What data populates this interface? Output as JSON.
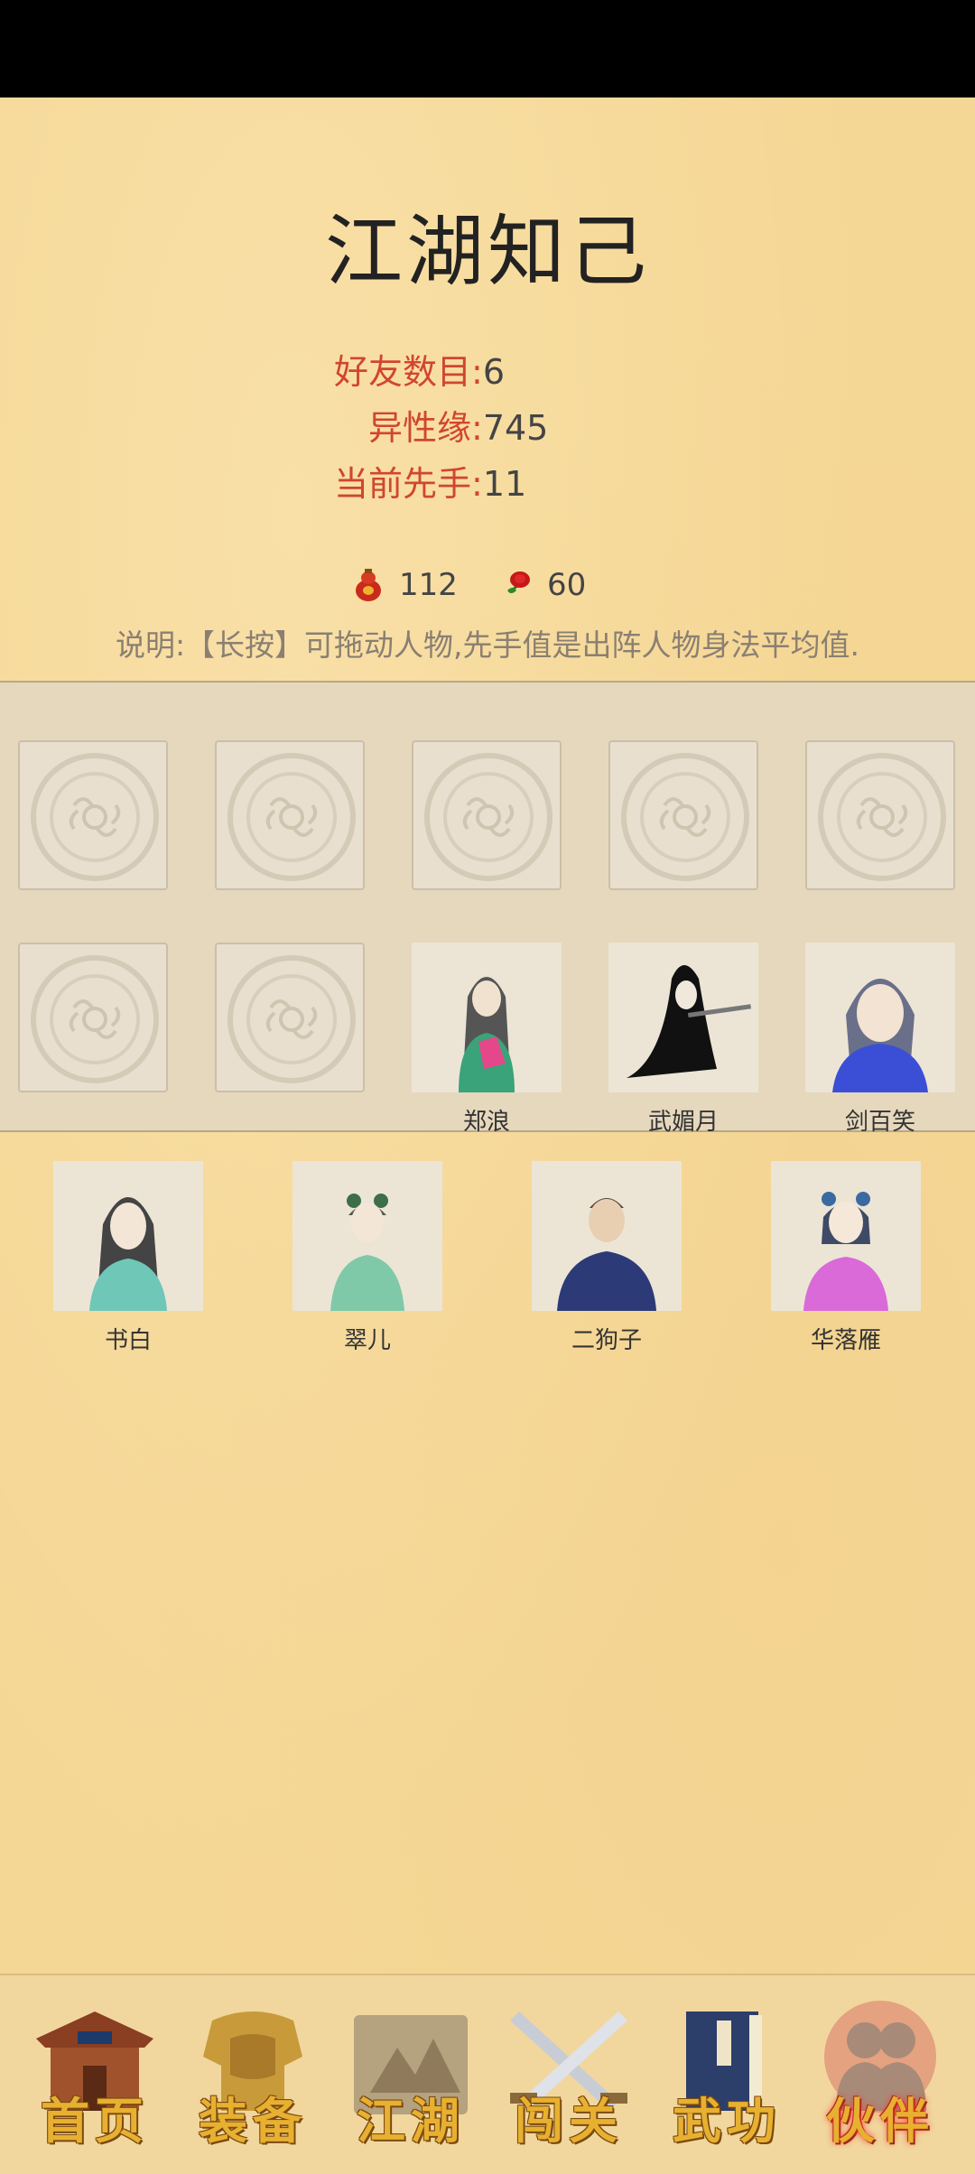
{
  "page": {
    "title": "江湖知己",
    "stats": [
      {
        "label": "好友数目:",
        "value": "6"
      },
      {
        "label": "异性缘:",
        "value": "745"
      },
      {
        "label": "当前先手:",
        "value": "11"
      }
    ],
    "currency": [
      {
        "icon": "red-gourd-icon",
        "value": "112"
      },
      {
        "icon": "rose-icon",
        "value": "60"
      }
    ],
    "note": "说明:【长按】可拖动人物,先手值是出阵人物身法平均值."
  },
  "lineup": {
    "empty_slots": 7,
    "characters": [
      {
        "name": "郑浪",
        "color": "#3aa37a"
      },
      {
        "name": "武媚月",
        "color": "#111111"
      },
      {
        "name": "剑百笑",
        "color": "#3a4fd6"
      }
    ]
  },
  "reserve": {
    "characters": [
      {
        "name": "书白",
        "color": "#6fc7b8"
      },
      {
        "name": "翠儿",
        "color": "#7fc9a8"
      },
      {
        "name": "二狗子",
        "color": "#2c3a78"
      },
      {
        "name": "华落雁",
        "color": "#d96ad8"
      }
    ]
  },
  "nav": {
    "items": [
      {
        "label": "首页",
        "icon": "house-icon"
      },
      {
        "label": "装备",
        "icon": "armor-icon"
      },
      {
        "label": "江湖",
        "icon": "scroll-map-icon"
      },
      {
        "label": "闯关",
        "icon": "crossed-swords-icon"
      },
      {
        "label": "武功",
        "icon": "book-icon"
      },
      {
        "label": "伙伴",
        "icon": "companions-icon",
        "active": true
      }
    ]
  }
}
